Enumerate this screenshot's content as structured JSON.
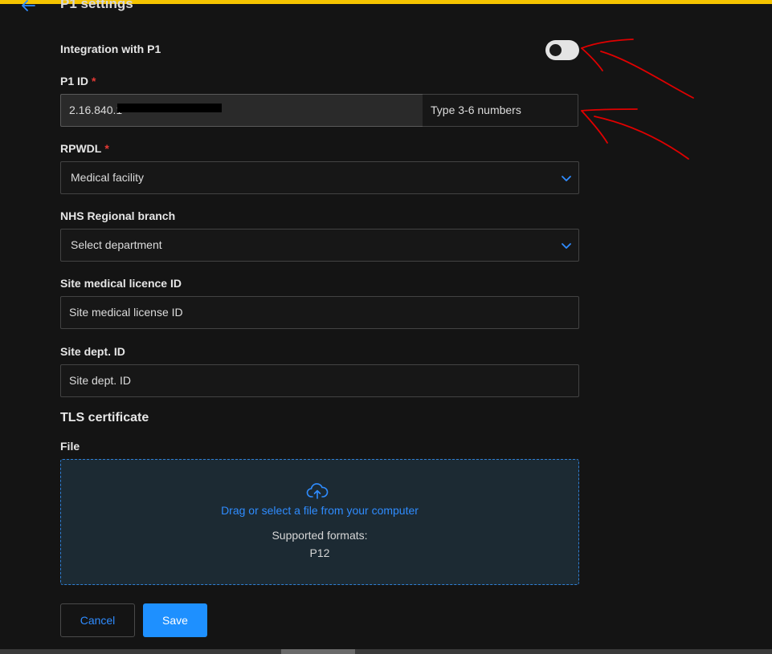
{
  "header": {
    "title": "P1 settings"
  },
  "integration": {
    "label": "Integration with P1",
    "enabled": false
  },
  "p1_id": {
    "label": "P1 ID",
    "required_mark": "*",
    "value": "2.16.840.1",
    "hint": "Type 3-6 numbers"
  },
  "rpwdl": {
    "label": "RPWDL",
    "required_mark": "*",
    "selected": "Medical facility"
  },
  "nhs_branch": {
    "label": "NHS Regional branch",
    "selected": "Select department"
  },
  "site_licence": {
    "label": "Site medical licence ID",
    "placeholder": "Site medical license ID"
  },
  "site_dept": {
    "label": "Site dept. ID",
    "placeholder": "Site dept. ID"
  },
  "tls": {
    "section_title": "TLS certificate",
    "file_label": "File",
    "dropzone_link": "Drag or select a file from your computer",
    "supported_label": "Supported formats:",
    "formats": "P12"
  },
  "actions": {
    "cancel": "Cancel",
    "save": "Save"
  },
  "colors": {
    "accent": "#1e90ff",
    "required": "#e53935",
    "topbar": "#f5c400",
    "annotation": "#e00000"
  }
}
